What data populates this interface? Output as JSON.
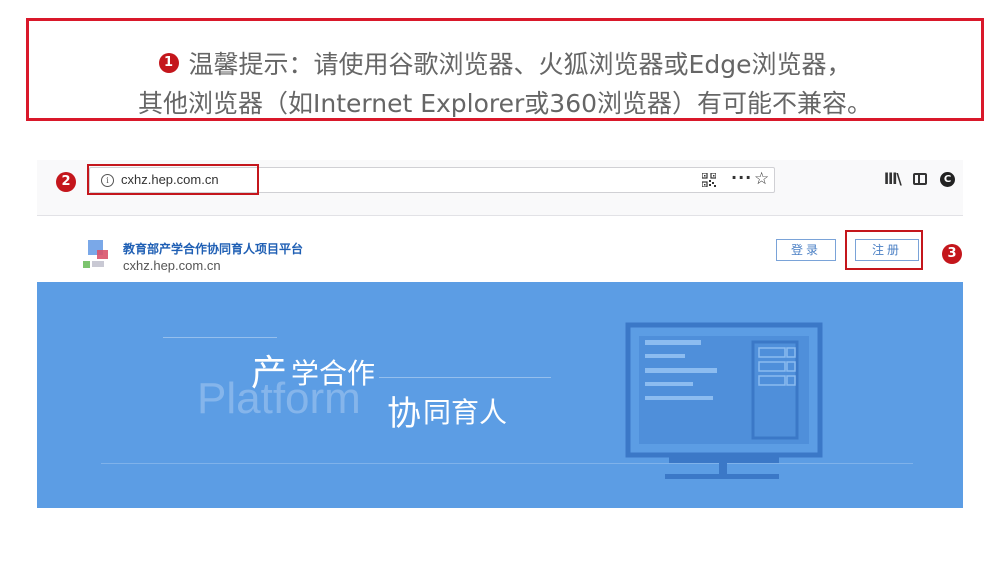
{
  "notice": {
    "badge": "1",
    "line1": "温馨提示：请使用谷歌浏览器、火狐浏览器或Edge浏览器，",
    "line2": "其他浏览器（如Internet Explorer或360浏览器）有可能不兼容。",
    "border_color": "#d9182a"
  },
  "browser": {
    "url_badge": "2",
    "url": "cxhz.hep.com.cn",
    "icons": [
      "info-icon",
      "qr-code-icon",
      "more-icon",
      "star-icon",
      "library-icon",
      "sidebar-icon",
      "account-icon"
    ],
    "more_glyph": "···",
    "star_glyph": "☆",
    "library_glyph": "lll\\",
    "account_glyph": "C"
  },
  "site": {
    "title": "教育部产学合作协同育人项目平台",
    "domain": "cxhz.hep.com.cn",
    "login_label": "登录",
    "register_label": "注册",
    "register_badge": "3",
    "accent_color": "#4a7fc4"
  },
  "banner": {
    "bg_color": "#5c9de4",
    "text_chan": "产",
    "text_xuehezuo": "学合作",
    "text_xie": "协",
    "text_tongyuren": "同育人",
    "platform": "Platform"
  }
}
